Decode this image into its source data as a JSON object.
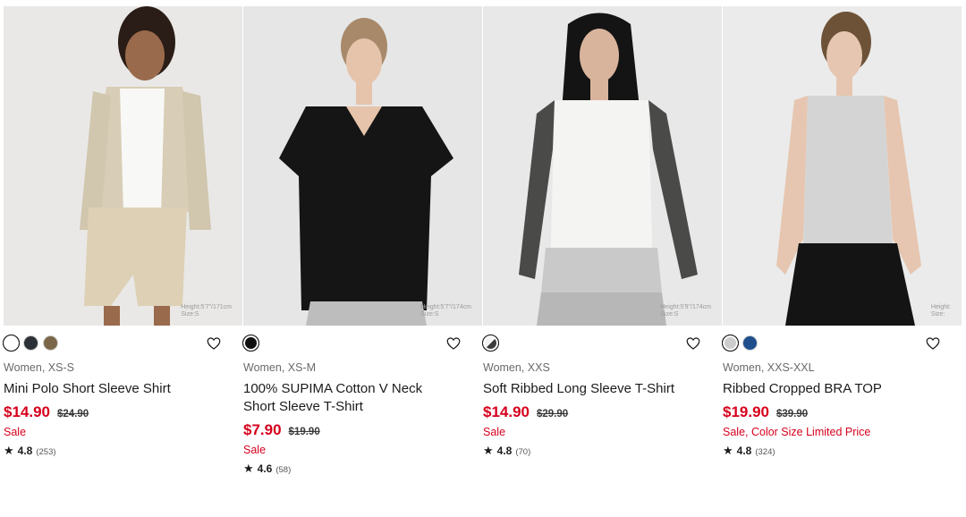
{
  "products": [
    {
      "model_note": [
        "Height:5'7\"/171cm",
        "Size:S"
      ],
      "colors": [
        "#ffffff",
        "#2b3137",
        "#7a6648"
      ],
      "meta": "Women, XS-S",
      "name_lines": [
        "Mini Polo Short Sleeve Shirt"
      ],
      "price": "$14.90",
      "was": "$24.90",
      "tag": "Sale",
      "rating": "4.8",
      "reviews": "(253)"
    },
    {
      "model_note": [
        "Height:5'7\"/174cm",
        "Size:S"
      ],
      "colors": [
        "#111111"
      ],
      "meta": "Women, XS-M",
      "name_lines": [
        "100% SUPIMA Cotton V Neck",
        "Short Sleeve T-Shirt"
      ],
      "price": "$7.90",
      "was": "$19.90",
      "tag": "Sale",
      "rating": "4.6",
      "reviews": "(58)"
    },
    {
      "model_note": [
        "Height:5'9\"/174cm",
        "Size:S"
      ],
      "colors": [
        "#3c3c3c"
      ],
      "meta": "Women, XXS",
      "name_lines": [
        "Soft Ribbed Long Sleeve T-Shirt"
      ],
      "price": "$14.90",
      "was": "$29.90",
      "tag": "Sale",
      "rating": "4.8",
      "reviews": "(70)"
    },
    {
      "model_note": [
        "Height:",
        "Size:"
      ],
      "colors": [
        "#cdcdcd",
        "#1f4e8c"
      ],
      "meta": "Women, XXS-XXL",
      "name_lines": [
        "Ribbed Cropped BRA TOP"
      ],
      "price": "$19.90",
      "was": "$39.90",
      "tag": "Sale, Color Size Limited Price",
      "rating": "4.8",
      "reviews": "(324)"
    }
  ],
  "icons": {
    "wishlist": "heart-outline-icon",
    "rating": "star-icon"
  }
}
